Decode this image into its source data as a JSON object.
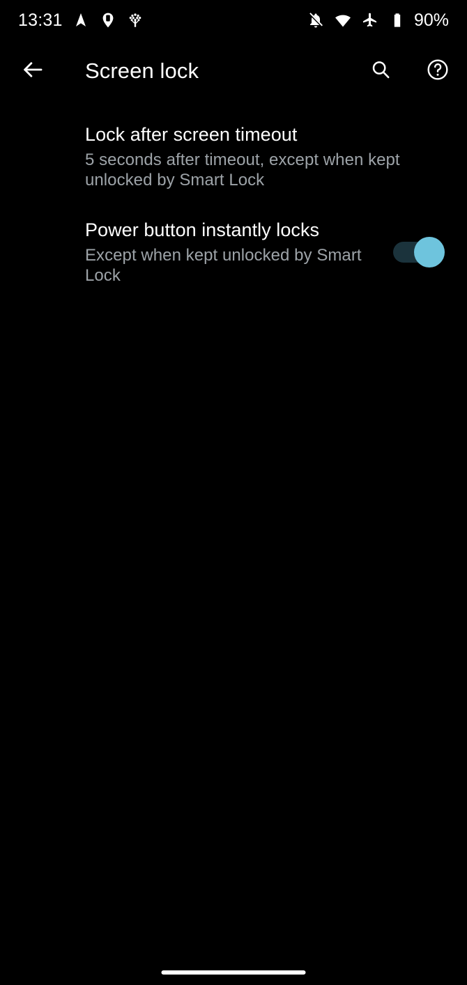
{
  "status_bar": {
    "clock": "13:31",
    "battery_percent": "90%",
    "left_icons": [
      {
        "name": "navigation-arrow-icon",
        "label": "Navigation"
      },
      {
        "name": "device-location-pin-icon",
        "label": "Find My Device"
      },
      {
        "name": "tree-app-icon",
        "label": "Tree app"
      }
    ],
    "right_icons": [
      {
        "name": "notifications-off-icon",
        "label": "Silent"
      },
      {
        "name": "wifi-icon",
        "label": "Wi-Fi"
      },
      {
        "name": "airplane-mode-icon",
        "label": "Airplane mode"
      },
      {
        "name": "battery-icon",
        "label": "Battery"
      }
    ]
  },
  "app_bar": {
    "title": "Screen lock",
    "back_icon": "arrow-back-icon",
    "search_icon": "search-icon",
    "help_icon": "help-circle-icon"
  },
  "preferences": [
    {
      "id": "lock-after-timeout",
      "title": "Lock after screen timeout",
      "summary": "5 seconds after timeout, except when kept unlocked by Smart Lock",
      "has_switch": false
    },
    {
      "id": "power-button",
      "title": "Power button instantly locks",
      "summary": "Except when kept unlocked by Smart Lock",
      "has_switch": true,
      "switch_on": true
    }
  ],
  "nav_bar": {
    "handle": "gesture-nav-handle"
  },
  "colors": {
    "background": "#000000",
    "primary_text": "#ffffff",
    "secondary_text": "#9da3a8",
    "switch_track_on": "#1b333c",
    "switch_thumb_on": "#6ec4dd"
  }
}
